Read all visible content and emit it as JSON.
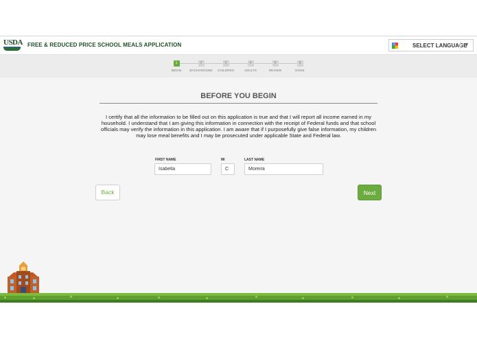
{
  "header": {
    "logo_text": "USDA",
    "app_title": "FREE & REDUCED PRICE SCHOOL MEALS APPLICATION",
    "language_label": "SELECT LANGUAGE"
  },
  "stepper": {
    "steps": [
      {
        "number": "1",
        "label": "BEGIN",
        "active": true
      },
      {
        "number": "2",
        "label": "BACKGROUND",
        "active": false
      },
      {
        "number": "3",
        "label": "CHILDREN",
        "active": false
      },
      {
        "number": "4",
        "label": "ADULTS",
        "active": false
      },
      {
        "number": "5",
        "label": "REVIEW",
        "active": false
      },
      {
        "number": "6",
        "label": "DONE",
        "active": false
      }
    ]
  },
  "main": {
    "heading": "BEFORE YOU BEGIN",
    "certification": "I certify that all the information to be filled out on this application is true and that I will report all income earned in my household. I understand that I am giving this information in connection with the receipt of Federal funds and that school officials may verify the information in this application. I am aware that if I purposefully give false information, my children may lose meal benefits and I may be prosecuted under applicable State and Federal law.",
    "fields": {
      "first_name_label": "FIRST NAME",
      "first_name_value": "Isabella",
      "mi_label": "MI",
      "mi_value": "C",
      "last_name_label": "LAST NAME",
      "last_name_value": "Moreira"
    },
    "back_label": "Back",
    "next_label": "Next"
  },
  "colors": {
    "accent": "#6cab3f",
    "brand_green": "#1f4f2a",
    "page_bg": "#f5f5f5"
  },
  "icons": [
    "usda-logo-icon",
    "google-translate-icon",
    "dropdown-arrow-icon",
    "school-building-icon"
  ]
}
